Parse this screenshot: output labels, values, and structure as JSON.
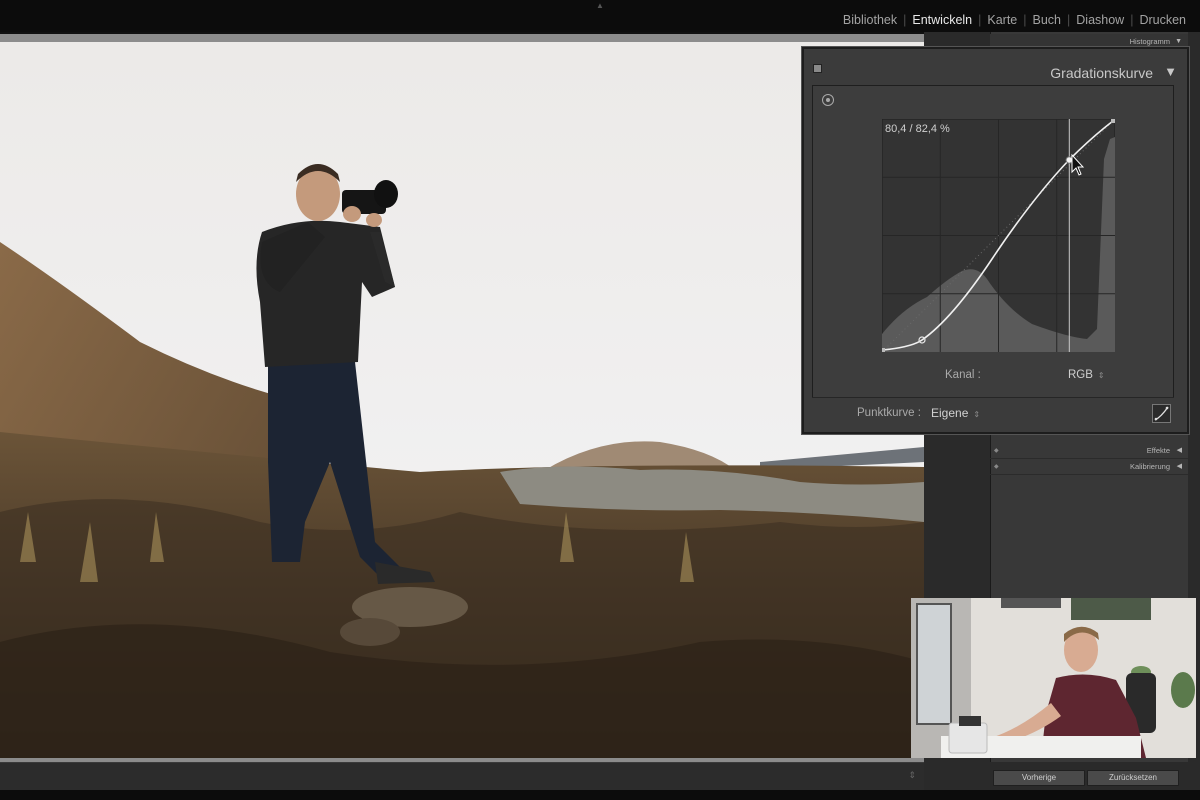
{
  "modules": [
    {
      "label": "Bibliothek",
      "active": false
    },
    {
      "label": "Entwickeln",
      "active": true
    },
    {
      "label": "Karte",
      "active": false
    },
    {
      "label": "Buch",
      "active": false
    },
    {
      "label": "Diashow",
      "active": false
    },
    {
      "label": "Drucken",
      "active": false
    }
  ],
  "module_separator": "|",
  "right_panel": {
    "histogram_label": "Histogramm",
    "sections": [
      {
        "label": "Effekte"
      },
      {
        "label": "Kalibrierung"
      }
    ]
  },
  "tone_curve": {
    "title": "Gradationskurve",
    "readout": "80,4 / 82,4 %",
    "channel_label": "Kanal :",
    "channel_value": "RGB",
    "point_curve_label": "Punktkurve :",
    "point_curve_value": "Eigene",
    "selected_point_percent": [
      80.4,
      82.4
    ]
  },
  "bottom": {
    "prev_label": "Vorherige",
    "reset_label": "Zurücksetzen"
  },
  "colors": {
    "active_module": "#e8e8e8",
    "inactive_module": "#a3a3a3",
    "panel_bg": "#3b3b3b"
  },
  "icons": {
    "collapse": "triangle-down-icon",
    "target_adjust": "target-icon",
    "point_curve": "curve-edit-icon"
  }
}
